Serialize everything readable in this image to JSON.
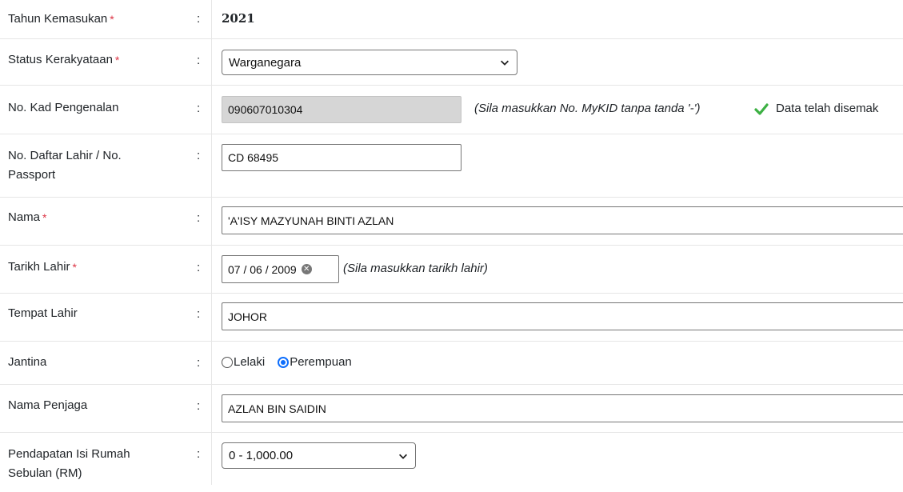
{
  "fields": {
    "tahun": {
      "label": "Tahun Kemasukan",
      "required": "*",
      "value": "2021"
    },
    "status": {
      "label": "Status Kerakyataan",
      "required": "*",
      "value": "Warganegara"
    },
    "kad": {
      "label": "No. Kad Pengenalan",
      "value": "090607010304",
      "hint": "(Sila masukkan No. MyKID tanpa tanda '-')",
      "verified_text": "Data telah disemak"
    },
    "daftar": {
      "label_line1": "No. Daftar Lahir / No.",
      "label_line2": "Passport",
      "value": "CD 68495"
    },
    "nama": {
      "label": "Nama",
      "required": "*",
      "value": "'A'ISY MAZYUNAH BINTI AZLAN"
    },
    "tarikh": {
      "label": "Tarikh Lahir",
      "required": "*",
      "value": "07 / 06 / 2009",
      "hint": "(Sila masukkan tarikh lahir)"
    },
    "tempat": {
      "label": "Tempat Lahir",
      "value": "JOHOR"
    },
    "jantina": {
      "label": "Jantina",
      "options": [
        "Lelaki",
        "Perempuan"
      ],
      "selected": "Perempuan"
    },
    "penjaga": {
      "label": "Nama Penjaga",
      "value": "AZLAN BIN SAIDIN"
    },
    "pendapatan": {
      "label_line1": "Pendapatan Isi Rumah",
      "label_line2": "Sebulan (RM)",
      "value": "0 - 1,000.00"
    }
  },
  "colon": ":",
  "colors": {
    "required": "#dc3545",
    "check": "#3cb043",
    "radio_selected": "#0d6efd"
  },
  "icons": {
    "dropdown": "chevron-down-icon",
    "verified": "checkmark-icon",
    "clear": "clear-circle-icon"
  }
}
